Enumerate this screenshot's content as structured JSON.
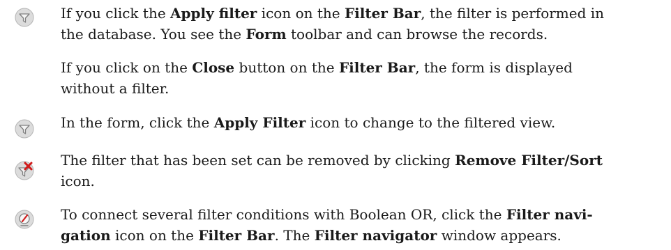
{
  "paragraphs": [
    {
      "icon": "apply-filter-icon",
      "lines": [
        [
          {
            "t": "If you click the "
          },
          {
            "t": "Apply filter",
            "b": true
          },
          {
            "t": " icon on the "
          },
          {
            "t": "Filter Bar",
            "b": true
          },
          {
            "t": ", the filter is performed in"
          }
        ],
        [
          {
            "t": "the database. You see the "
          },
          {
            "t": "Form",
            "b": true
          },
          {
            "t": " toolbar and can browse the records."
          }
        ]
      ]
    },
    {
      "icon": null,
      "lines": [
        [
          {
            "t": "If you click on the "
          },
          {
            "t": "Close",
            "b": true
          },
          {
            "t": " button on the "
          },
          {
            "t": "Filter Bar",
            "b": true
          },
          {
            "t": ", the form is displayed"
          }
        ],
        [
          {
            "t": "without a filter."
          }
        ]
      ]
    },
    {
      "icon": "apply-filter-icon",
      "lines": [
        [
          {
            "t": "In the form, click the "
          },
          {
            "t": "Apply Filter",
            "b": true
          },
          {
            "t": " icon to change to the filtered view."
          }
        ]
      ]
    },
    {
      "icon": "remove-filter-icon",
      "lines": [
        [
          {
            "t": "The filter that has been set can be removed by clicking "
          },
          {
            "t": "Remove Filter/Sort",
            "b": true
          }
        ],
        [
          {
            "t": "icon."
          }
        ]
      ]
    },
    {
      "icon": "filter-navigator-icon",
      "lines": [
        [
          {
            "t": "To connect several filter conditions with Boolean OR, click the "
          },
          {
            "t": "Filter navi-",
            "b": true
          }
        ],
        [
          {
            "t": "gation",
            "b": true
          },
          {
            "t": " icon on the "
          },
          {
            "t": "Filter Bar",
            "b": true
          },
          {
            "t": ". The "
          },
          {
            "t": "Filter navigator",
            "b": true
          },
          {
            "t": " window appears."
          }
        ]
      ]
    }
  ]
}
